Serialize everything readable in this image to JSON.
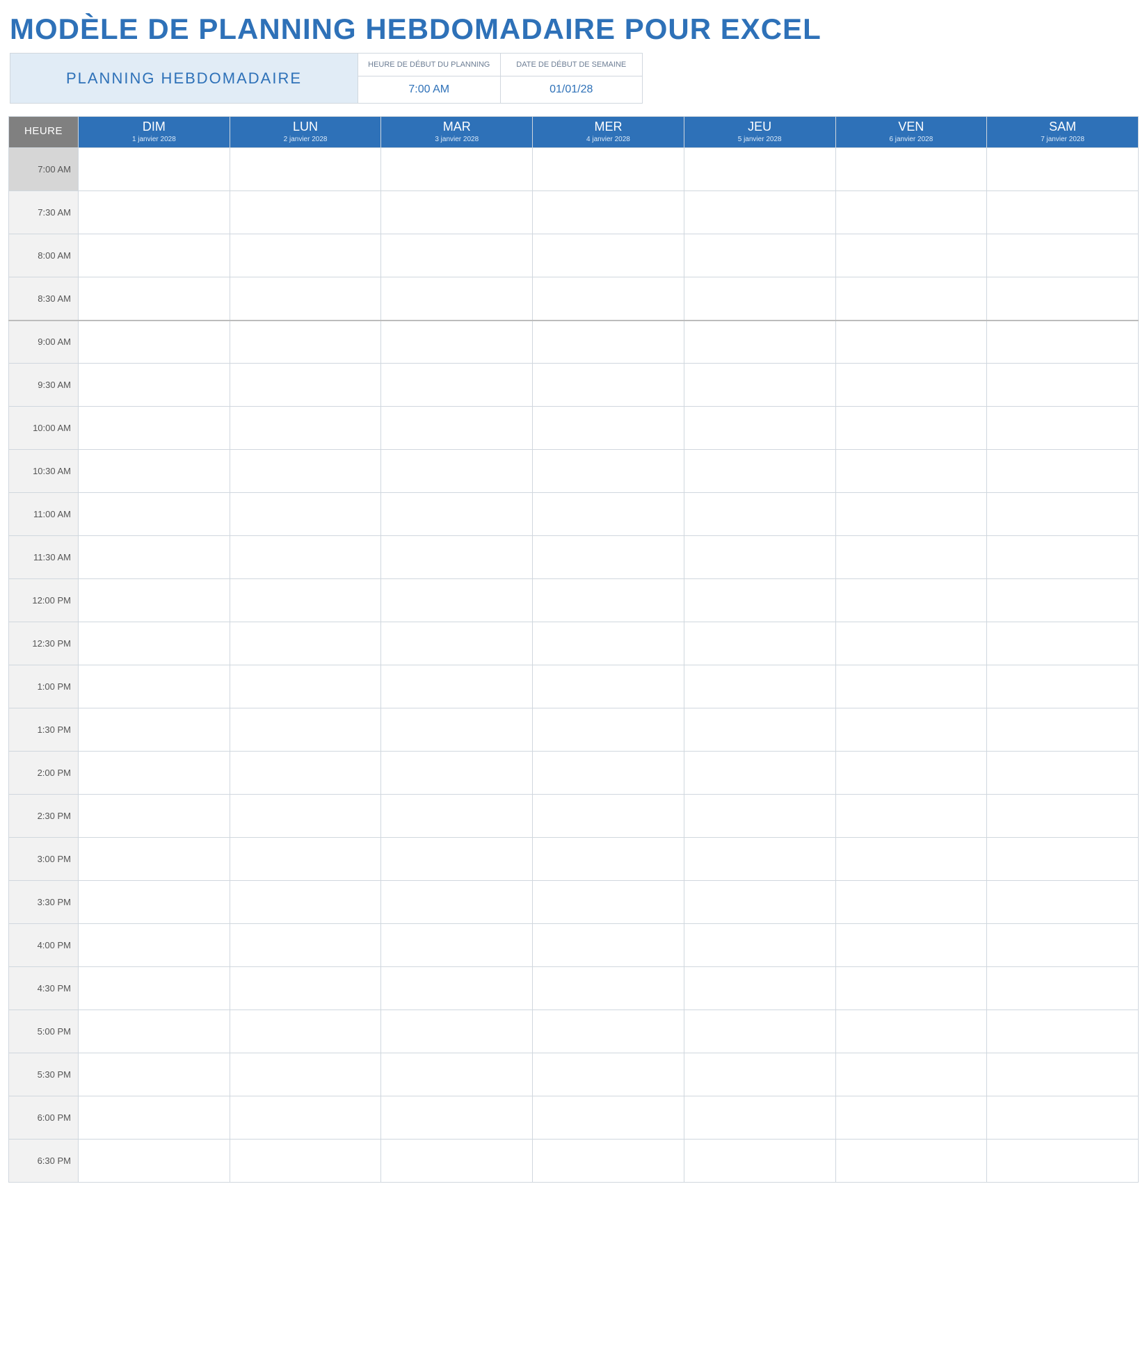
{
  "title": "MODÈLE DE PLANNING HEBDOMADAIRE POUR EXCEL",
  "header": {
    "planning_label": "PLANNING HEBDOMADAIRE",
    "start_time_label": "HEURE DE DÉBUT DU PLANNING",
    "start_date_label": "DATE DE DÉBUT DE SEMAINE",
    "start_time_value": "7:00 AM",
    "start_date_value": "01/01/28"
  },
  "columns": {
    "hour_label": "HEURE",
    "days": [
      {
        "short": "DIM",
        "date": "1 janvier 2028"
      },
      {
        "short": "LUN",
        "date": "2 janvier 2028"
      },
      {
        "short": "MAR",
        "date": "3 janvier 2028"
      },
      {
        "short": "MER",
        "date": "4 janvier 2028"
      },
      {
        "short": "JEU",
        "date": "5 janvier 2028"
      },
      {
        "short": "VEN",
        "date": "6 janvier 2028"
      },
      {
        "short": "SAM",
        "date": "7 janvier 2028"
      }
    ]
  },
  "time_slots": [
    "7:00 AM",
    "7:30 AM",
    "8:00 AM",
    "8:30 AM",
    "9:00 AM",
    "9:30 AM",
    "10:00 AM",
    "10:30 AM",
    "11:00 AM",
    "11:30 AM",
    "12:00 PM",
    "12:30 PM",
    "1:00 PM",
    "1:30 PM",
    "2:00 PM",
    "2:30 PM",
    "3:00 PM",
    "3:30 PM",
    "4:00 PM",
    "4:30 PM",
    "5:00 PM",
    "5:30 PM",
    "6:00 PM",
    "6:30 PM"
  ],
  "block_separator_after": [
    3
  ]
}
